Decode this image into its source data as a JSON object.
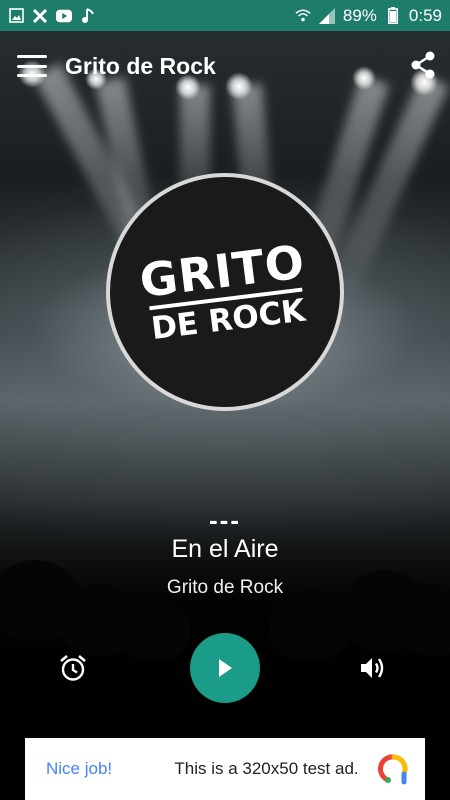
{
  "status_bar": {
    "battery": "89%",
    "time": "0:59",
    "left_icons": [
      "image-icon",
      "x-icon",
      "youtube-icon",
      "music-note-icon"
    ],
    "right_icons": [
      "wifi-icon",
      "signal-icon",
      "battery-icon"
    ]
  },
  "toolbar": {
    "title": "Grito de Rock",
    "menu_icon": "hamburger-menu-icon",
    "share_icon": "share-icon"
  },
  "logo": {
    "line1": "GRITO",
    "line2": "DE ROCK"
  },
  "now_playing": {
    "placeholder": "---",
    "title": "En el Aire",
    "station": "Grito de Rock"
  },
  "controls": {
    "alarm_icon": "alarm-clock-icon",
    "play_icon": "play-icon",
    "volume_icon": "volume-icon"
  },
  "ad": {
    "cta": "Nice job!",
    "text": "This is a 320x50 test ad.",
    "logo_icon": "ad-logo-icon"
  },
  "colors": {
    "status_bar": "#1e7d6a",
    "play_button": "#1a9c89",
    "ad_cta": "#4285f4"
  }
}
